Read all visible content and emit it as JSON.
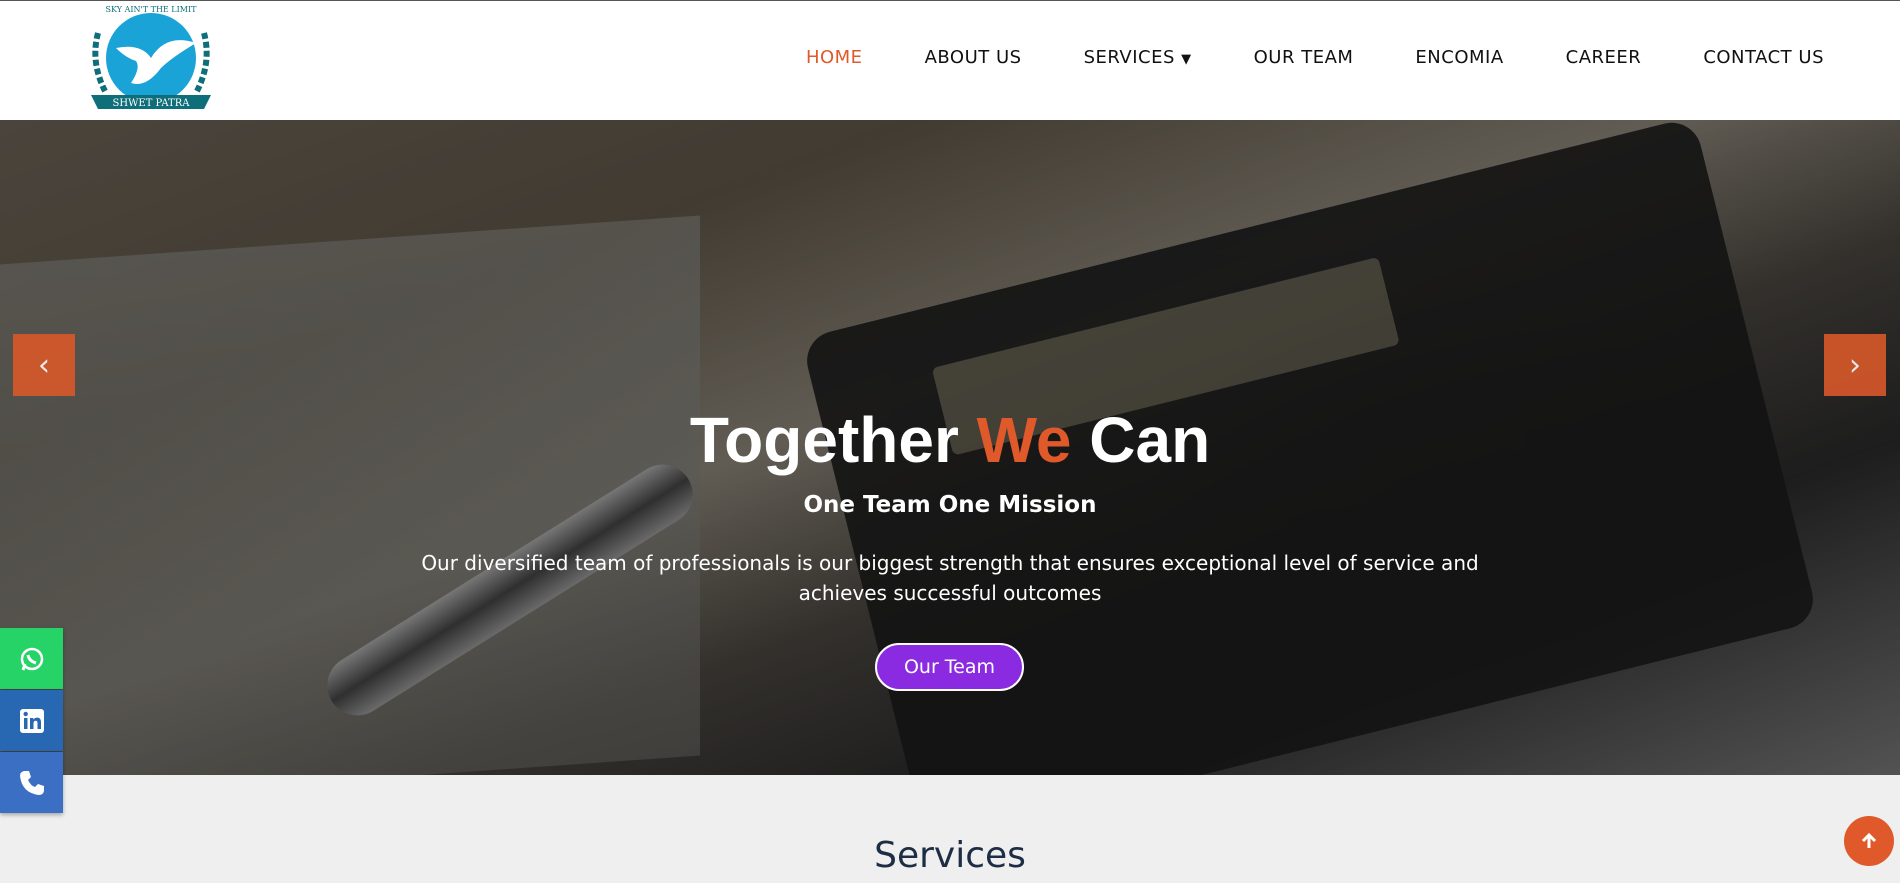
{
  "logo": {
    "top_text": "SKY AIN'T THE LIMIT",
    "name": "SHWET PATRA"
  },
  "nav": [
    {
      "label": "HOME"
    },
    {
      "label": "ABOUT US"
    },
    {
      "label": "SERVICES"
    },
    {
      "label": "OUR TEAM"
    },
    {
      "label": "ENCOMIA"
    },
    {
      "label": "CAREER"
    },
    {
      "label": "CONTACT US"
    }
  ],
  "hero": {
    "title_a": "Together ",
    "title_b": "We",
    "title_c": " Can",
    "subtitle": "One Team One Mission",
    "desc_line1": "Our diversified team of professionals is our biggest strength that ensures exceptional level of service and",
    "desc_line2": "achieves successful outcomes",
    "button": "Our Team",
    "prev": "‹",
    "next": "›"
  },
  "services_title": "Services",
  "colors": {
    "accent": "#e0592a",
    "button": "#8a2be2",
    "whatsapp": "#25d366",
    "linkedin": "#2867b2",
    "phone": "#3b6fc4"
  }
}
